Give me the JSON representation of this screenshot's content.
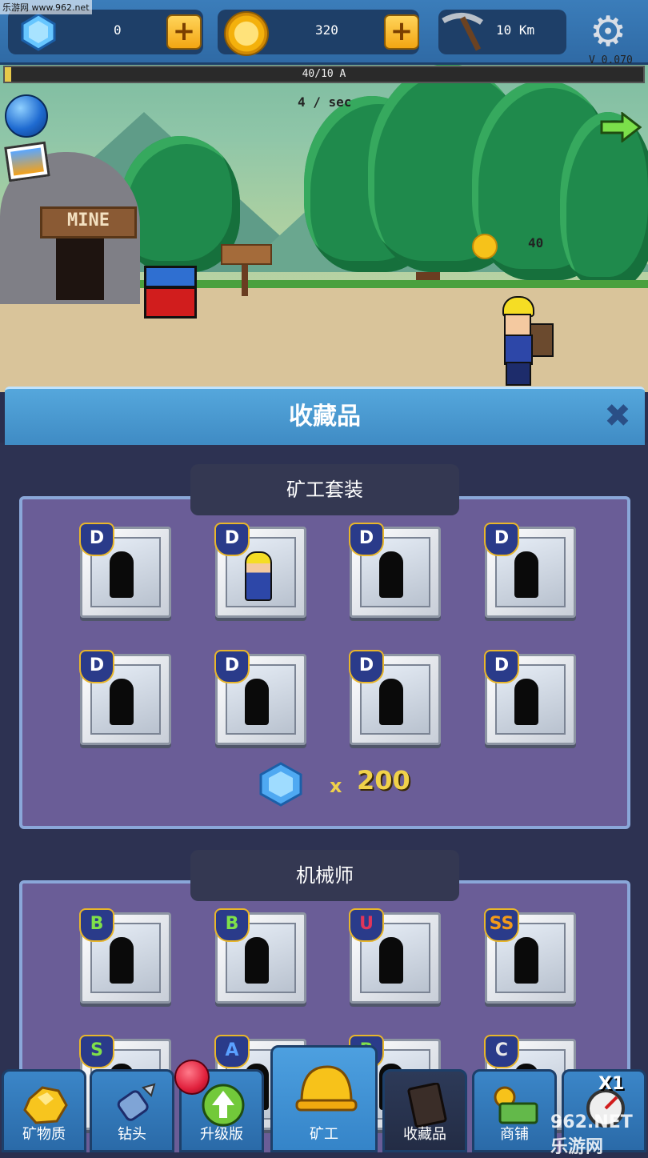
{
  "watermark": "乐游网 www.962.net",
  "watermark_bottom": "962.NET 乐游网",
  "topbar": {
    "gems": "0",
    "coins": "320",
    "distance": "10 Km",
    "plus": "+",
    "version": "V 0.070",
    "version_pct": "1%"
  },
  "progress": {
    "text": "40/10 A",
    "fraction": 0.01
  },
  "scene": {
    "rate": "4 / sec",
    "cave_sign": "MINE",
    "coin_popup": "40"
  },
  "panel": {
    "title": "收藏品",
    "close": "✖"
  },
  "sections": [
    {
      "title": "矿工套装",
      "cards": [
        {
          "badge": "D",
          "badge_color": "#ffffff",
          "unlocked": false
        },
        {
          "badge": "D",
          "badge_color": "#ffffff",
          "unlocked": true
        },
        {
          "badge": "D",
          "badge_color": "#ffffff",
          "unlocked": false
        },
        {
          "badge": "D",
          "badge_color": "#ffffff",
          "unlocked": false
        },
        {
          "badge": "D",
          "badge_color": "#ffffff",
          "unlocked": false
        },
        {
          "badge": "D",
          "badge_color": "#ffffff",
          "unlocked": false
        },
        {
          "badge": "D",
          "badge_color": "#ffffff",
          "unlocked": false
        },
        {
          "badge": "D",
          "badge_color": "#ffffff",
          "unlocked": false
        }
      ],
      "reward_mult": "x",
      "reward_value": "200"
    },
    {
      "title": "机械师",
      "cards": [
        {
          "badge": "B",
          "badge_color": "#7fe04a",
          "unlocked": false
        },
        {
          "badge": "B",
          "badge_color": "#7fe04a",
          "unlocked": false
        },
        {
          "badge": "U",
          "badge_color": "#e0355a",
          "unlocked": false
        },
        {
          "badge": "SS",
          "badge_color": "#f39a1a",
          "unlocked": false
        },
        {
          "badge": "S",
          "badge_color": "#7fe04a",
          "unlocked": false
        },
        {
          "badge": "A",
          "badge_color": "#5aa0ff",
          "unlocked": false
        },
        {
          "badge": "B",
          "badge_color": "#7fe04a",
          "unlocked": false
        },
        {
          "badge": "C",
          "badge_color": "#e8e8e8",
          "unlocked": false
        }
      ]
    }
  ],
  "nav": {
    "minerals": "矿物质",
    "drill": "钻头",
    "upgrade": "升级版",
    "miner": "矿工",
    "collection": "收藏品",
    "shop": "商铺",
    "speed": "X1"
  },
  "colors": {
    "accent": "#3f8bc4",
    "section_bg": "#6a5d97",
    "gold": "#f0d14a"
  }
}
